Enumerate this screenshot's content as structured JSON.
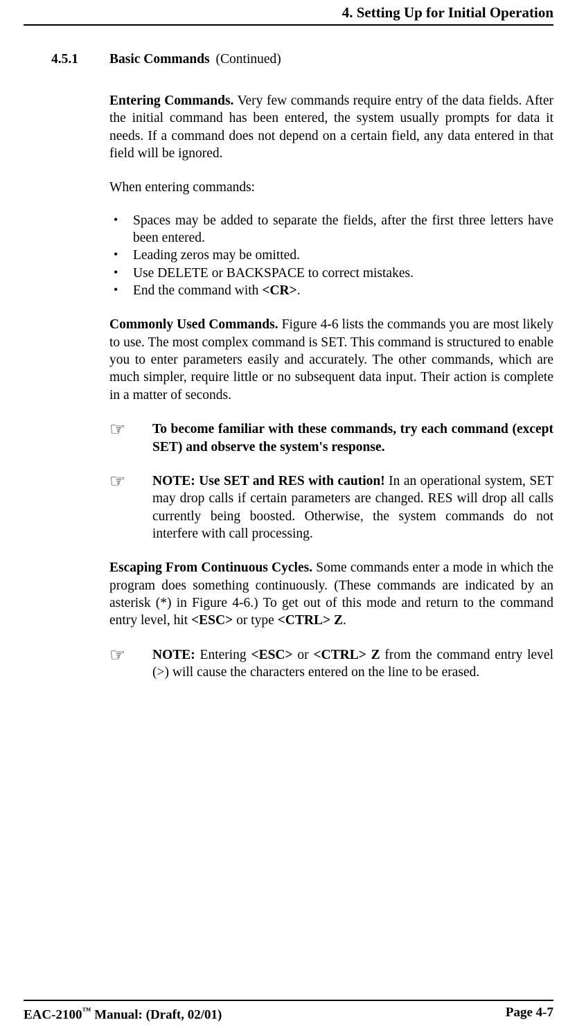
{
  "header": {
    "chapter_title": "4. Setting Up for Initial Operation"
  },
  "section": {
    "number": "4.5.1",
    "title": "Basic Commands",
    "continued": "(Continued)"
  },
  "p1": {
    "runin": "Entering Commands.",
    "text": " Very few commands require entry of the data fields. After the initial command has been entered, the system usually prompts for data it needs. If a command does not depend on a certain field, any data entered in that field will be ignored."
  },
  "p2": "When entering commands:",
  "bullets": [
    "Spaces may be added to separate the fields, after the first three letters have been entered.",
    "Leading zeros may be omitted.",
    "Use DELETE or BACKSPACE to correct mistakes."
  ],
  "bullet4_a": "End the command with ",
  "bullet4_b": "<CR>",
  "bullet4_c": ".",
  "p3": {
    "runin": "Commonly Used Commands.",
    "text": " Figure 4-6 lists the commands you are most likely to use. The most complex command is SET. This command is structured to enable you to enter parameters easily and accurately. The other commands, which are much simpler, require little or no subsequent data input. Their action is complete in a matter of seconds."
  },
  "note1": "To become familiar with these commands, try each command (except SET) and observe the system's response.",
  "note2": {
    "runin": "NOTE: Use SET and RES with caution!",
    "text": " In an operational system, SET may drop calls if certain parameters are changed. RES will drop all calls currently being boosted. Otherwise, the system commands do not interfere with call processing."
  },
  "p4": {
    "runin": "Escaping From Continuous Cycles.",
    "text_a": " Some commands enter a mode in which the program does something continuously. (These commands are indicated by an asterisk (*) in Figure 4-6.) To get out of this mode and return to the command entry level, hit ",
    "esc": "<ESC>",
    "text_b": " or type ",
    "ctrlz": "<CTRL> Z",
    "text_c": "."
  },
  "note3": {
    "runin": "NOTE:",
    "text_a": " Entering ",
    "esc": "<ESC>",
    "text_b": " or ",
    "ctrlz": "<CTRL> Z",
    "text_c": " from the command entry level (>) will cause the characters entered on the line to be erased."
  },
  "footer": {
    "left_a": "EAC-2100",
    "left_tm": "",
    "left_b": " Manual: (Draft, 02/01)",
    "right": "Page 4-7"
  }
}
